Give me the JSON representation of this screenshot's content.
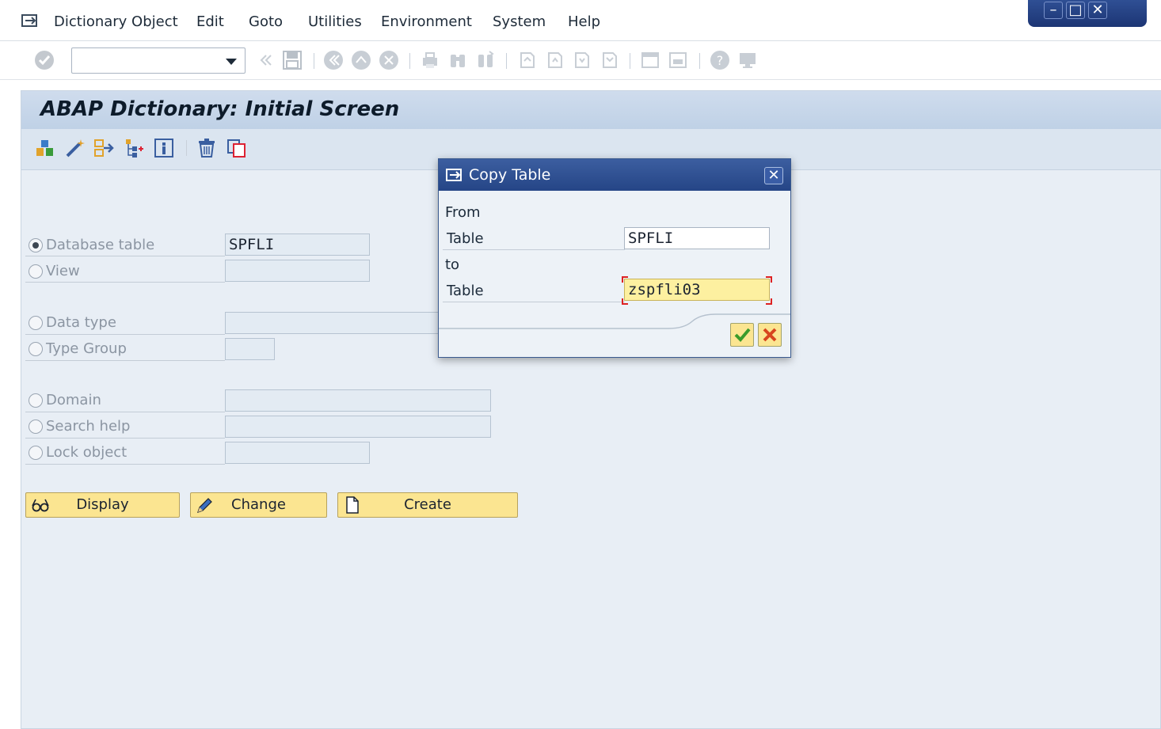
{
  "menubar": {
    "items": [
      "Dictionary Object",
      "Edit",
      "Goto",
      "Utilities",
      "Environment",
      "System",
      "Help"
    ]
  },
  "window_controls": {
    "minimize": "–",
    "maximize": "□",
    "close": "✕"
  },
  "toolbar": {
    "command_field_value": ""
  },
  "page": {
    "title": "ABAP Dictionary: Initial Screen"
  },
  "form": {
    "database_table": {
      "label": "Database table",
      "value": "SPFLI",
      "selected": true
    },
    "view": {
      "label": "View",
      "value": ""
    },
    "data_type": {
      "label": "Data type",
      "value": ""
    },
    "type_group": {
      "label": "Type Group",
      "value": ""
    },
    "domain": {
      "label": "Domain",
      "value": ""
    },
    "search_help": {
      "label": "Search help",
      "value": ""
    },
    "lock_object": {
      "label": "Lock object",
      "value": ""
    }
  },
  "buttons": {
    "display": "Display",
    "change": "Change",
    "create": "Create"
  },
  "dialog": {
    "title": "Copy Table",
    "close": "✕",
    "from_label": "From",
    "from_table_label": "Table",
    "from_table_value": "SPFLI",
    "to_label": "to",
    "to_table_label": "Table",
    "to_table_value": "zspfli03"
  },
  "colors": {
    "accent": "#254586",
    "button": "#fbe591",
    "background": "#e8eef5"
  }
}
